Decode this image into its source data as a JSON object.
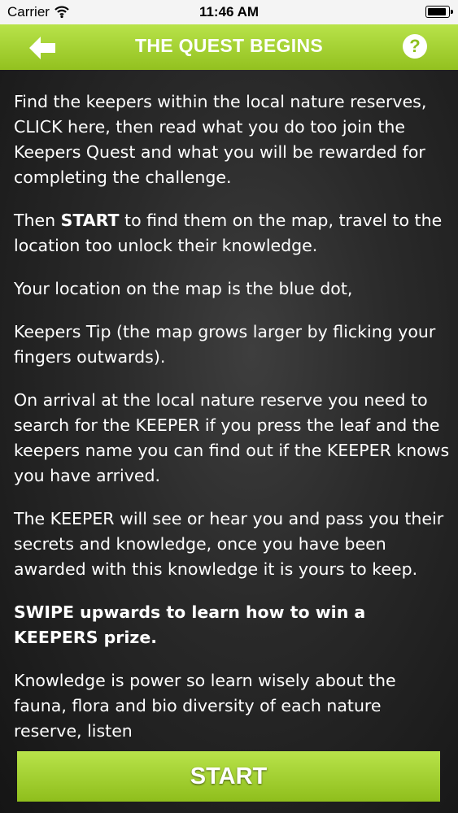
{
  "status_bar": {
    "carrier": "Carrier",
    "time": "11:46 AM"
  },
  "header": {
    "title": "THE QUEST BEGINS",
    "back_icon": "back-arrow-icon",
    "help_label": "?"
  },
  "content": {
    "p1": "Find the keepers within the local nature reserves, CLICK here, then read what you do too join the Keepers Quest and what you will be rewarded for completing the challenge.",
    "p2_strong": "START",
    "p2_pre": "Then ",
    "p2_post": " to find them on the map, travel to the location too unlock their knowledge.",
    "p3": "Your location on the map is the blue dot,",
    "p4": "Keepers Tip (the map grows larger by flicking your fingers outwards).",
    "p5": "On arrival at the local nature reserve you need to search for the KEEPER if you press the leaf and the keepers name you can find out if the KEEPER knows you have arrived.",
    "p6": "The KEEPER will see or hear you and pass you their secrets and knowledge, once you have been awarded with this knowledge it is yours to keep.",
    "p7": "SWIPE upwards to learn how to win a KEEPERS prize.",
    "p8": "Knowledge is power so learn wisely about the fauna, flora and bio diversity of each nature reserve, listen"
  },
  "footer": {
    "start_label": "START"
  },
  "colors": {
    "accent": "#9fcc2a",
    "background": "#222222"
  }
}
